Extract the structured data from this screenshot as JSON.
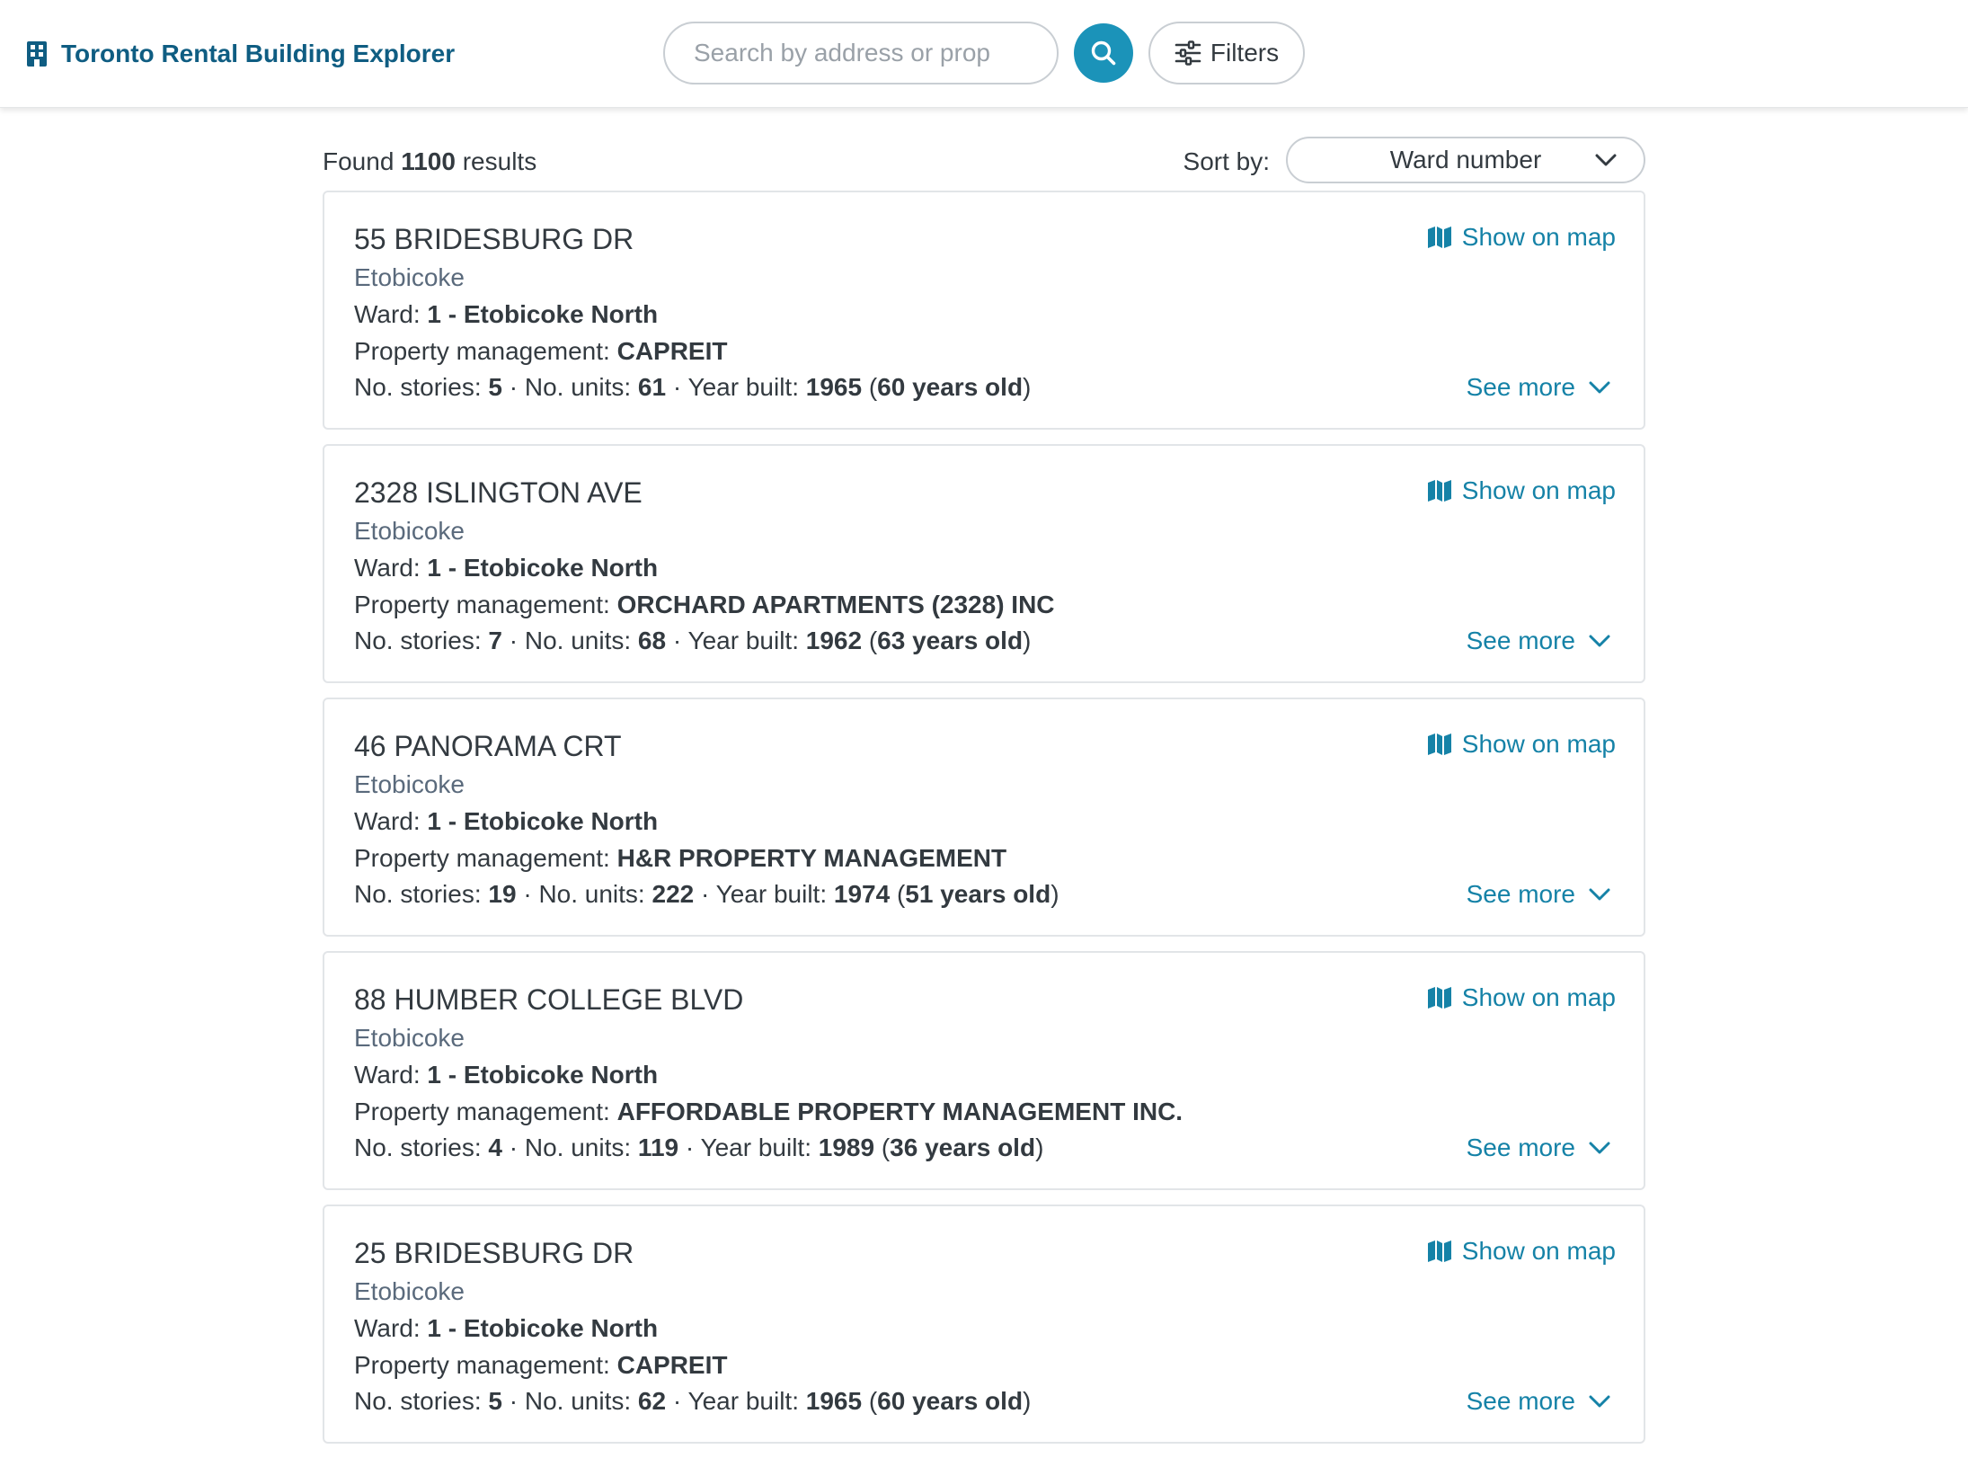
{
  "header": {
    "app_title": "Toronto Rental Building Explorer",
    "app_icon": "building-icon",
    "search_placeholder": "Search by address or prop",
    "search_value": "",
    "search_button_icon": "search-icon",
    "filters_label": "Filters",
    "filters_icon": "sliders-icon"
  },
  "results": {
    "found_prefix": "Found",
    "count": "1100",
    "found_suffix": "results",
    "sort_label": "Sort by:",
    "sort_value": "Ward number"
  },
  "labels": {
    "ward": "Ward:",
    "management": "Property management:",
    "stories": "No. stories:",
    "units": "No. units:",
    "year_built": "Year built:",
    "years_old_suffix": "years old",
    "show_on_map": "Show on map",
    "see_more": "See more"
  },
  "cards": [
    {
      "address": "55 BRIDESBURG DR",
      "district": "Etobicoke",
      "ward": "1 - Etobicoke North",
      "management": "CAPREIT",
      "stories": "5",
      "units": "61",
      "year_built": "1965",
      "years_old": "60"
    },
    {
      "address": "2328 ISLINGTON AVE",
      "district": "Etobicoke",
      "ward": "1 - Etobicoke North",
      "management": "ORCHARD APARTMENTS (2328) INC",
      "stories": "7",
      "units": "68",
      "year_built": "1962",
      "years_old": "63"
    },
    {
      "address": "46 PANORAMA CRT",
      "district": "Etobicoke",
      "ward": "1 - Etobicoke North",
      "management": "H&R PROPERTY MANAGEMENT",
      "stories": "19",
      "units": "222",
      "year_built": "1974",
      "years_old": "51"
    },
    {
      "address": "88 HUMBER COLLEGE BLVD",
      "district": "Etobicoke",
      "ward": "1 - Etobicoke North",
      "management": "AFFORDABLE PROPERTY MANAGEMENT INC.",
      "stories": "4",
      "units": "119",
      "year_built": "1989",
      "years_old": "36"
    },
    {
      "address": "25 BRIDESBURG DR",
      "district": "Etobicoke",
      "ward": "1 - Etobicoke North",
      "management": "CAPREIT",
      "stories": "5",
      "units": "62",
      "year_built": "1965",
      "years_old": "60"
    }
  ],
  "colors": {
    "brand": "#0f5d82",
    "accent": "#1b93b9",
    "link": "#1582a7",
    "district_text": "#5a6a7c",
    "border": "#e2e5e8"
  }
}
